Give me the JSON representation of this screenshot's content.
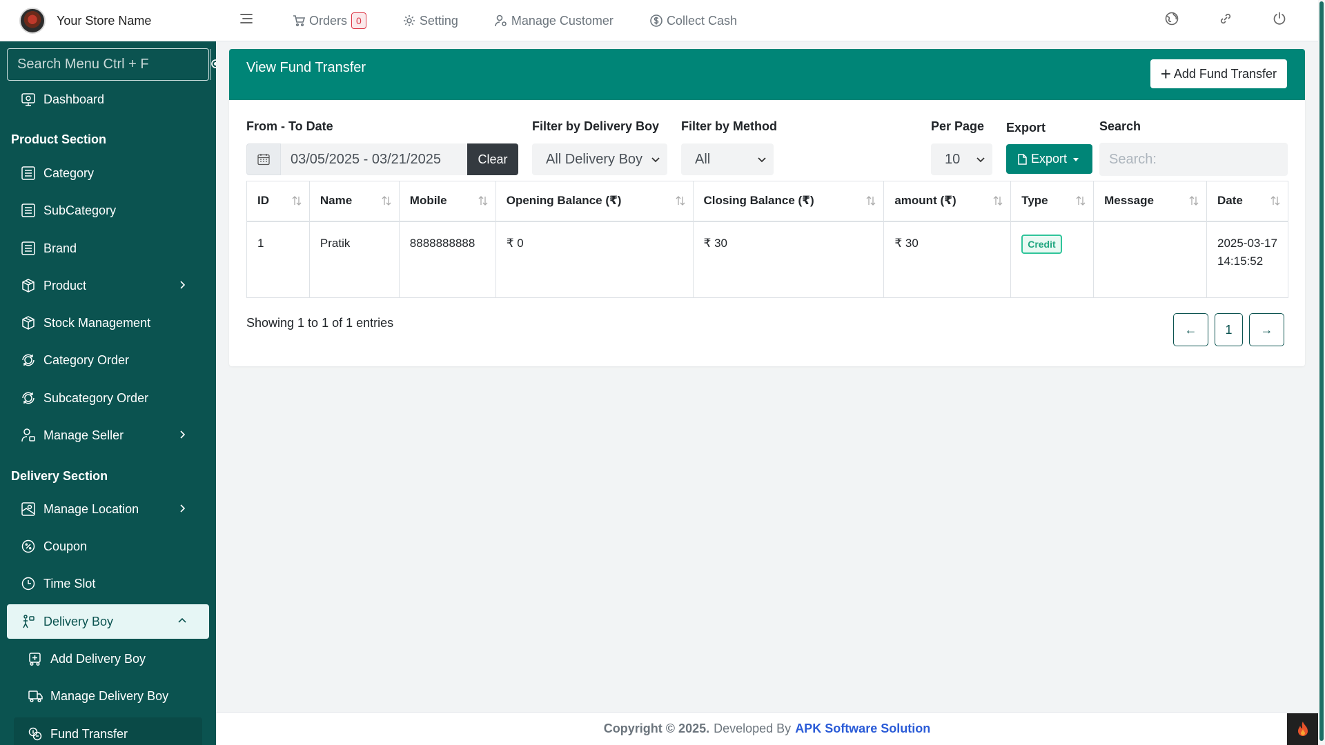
{
  "brand": {
    "name": "Your Store Name"
  },
  "topnav": {
    "orders_label": "Orders",
    "orders_count": "0",
    "setting_label": "Setting",
    "manage_customer_label": "Manage Customer",
    "collect_cash_label": "Collect Cash"
  },
  "sidebar": {
    "search_placeholder": "Search Menu Ctrl + F",
    "dashboard": "Dashboard",
    "product_section": "Product Section",
    "category": "Category",
    "subcategory": "SubCategory",
    "brand": "Brand",
    "product": "Product",
    "stock_management": "Stock Management",
    "category_order": "Category Order",
    "subcategory_order": "Subcategory Order",
    "manage_seller": "Manage Seller",
    "delivery_section": "Delivery Section",
    "manage_location": "Manage Location",
    "coupon": "Coupon",
    "time_slot": "Time Slot",
    "delivery_boy": "Delivery Boy",
    "add_delivery_boy": "Add Delivery Boy",
    "manage_delivery_boy": "Manage Delivery Boy",
    "fund_transfer": "Fund Transfer"
  },
  "page": {
    "title": "View Fund Transfer",
    "add_button": "Add Fund Transfer"
  },
  "filters": {
    "date_label": "From - To Date",
    "date_value": "03/05/2025 - 03/21/2025",
    "clear_label": "Clear",
    "delivery_boy_label": "Filter by Delivery Boy",
    "delivery_boy_value": "All Delivery Boy",
    "method_label": "Filter by Method",
    "method_value": "All",
    "per_page_label": "Per Page",
    "per_page_value": "10",
    "export_label": "Export",
    "export_button": "Export",
    "search_label": "Search",
    "search_placeholder": "Search:"
  },
  "table": {
    "headers": [
      "ID",
      "Name",
      "Mobile",
      "Opening Balance (₹)",
      "Closing Balance (₹)",
      "amount (₹)",
      "Type",
      "Message",
      "Date"
    ],
    "rows": [
      {
        "id": "1",
        "name": "Pratik",
        "mobile": "8888888888",
        "opening": "₹ 0",
        "closing": "₹ 30",
        "amount": "₹ 30",
        "type": "Credit",
        "message": "",
        "date": "2025-03-17 14:15:52"
      }
    ],
    "showing": "Showing 1 to 1 of 1 entries",
    "prev": "←",
    "page": "1",
    "next": "→"
  },
  "footer": {
    "copyright": "Copyright © 2025.",
    "developed_by": "Developed By",
    "developer": "APK Software Solution"
  },
  "colors": {
    "sidebar_bg": "#0b5350",
    "header_teal": "#008577",
    "credit_green": "#1ea57f",
    "badge_red": "#dc3545",
    "link_blue": "#2a5bd7"
  }
}
